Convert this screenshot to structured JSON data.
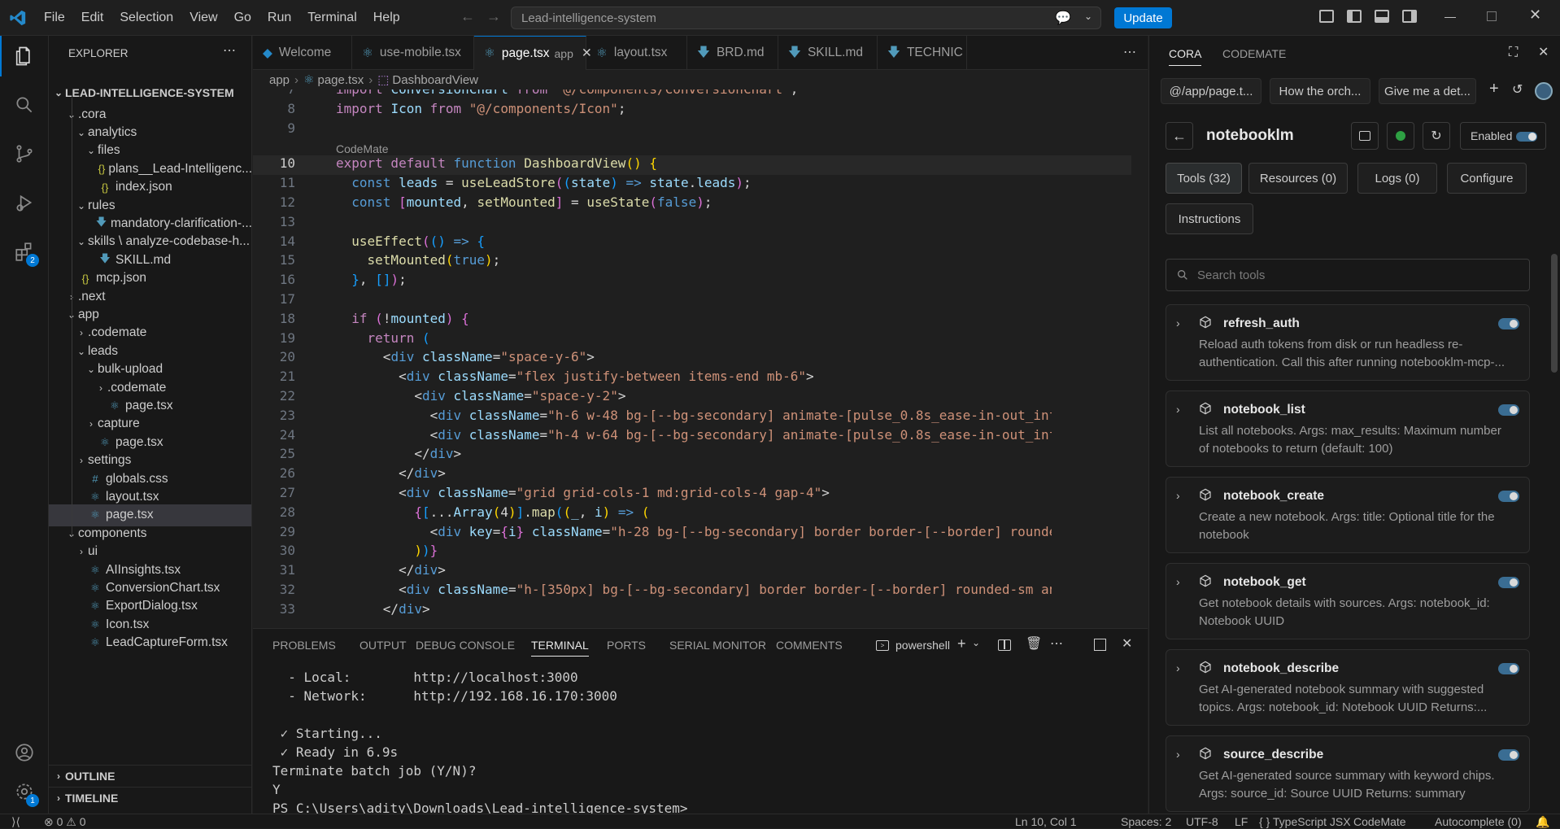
{
  "title_bar": {
    "menu": [
      "File",
      "Edit",
      "Selection",
      "View",
      "Go",
      "Run",
      "Terminal",
      "Help"
    ],
    "search_text": "Lead-intelligence-system",
    "update_label": "Update"
  },
  "activity_bar": {
    "extensions_badge": "2",
    "settings_badge": "1"
  },
  "explorer": {
    "header": "EXPLORER",
    "root": "LEAD-INTELLIGENCE-SYSTEM",
    "items": [
      {
        "label": ".cora",
        "indent": 1,
        "twisty": "open",
        "icon": "none"
      },
      {
        "label": "analytics",
        "indent": 2,
        "twisty": "open",
        "icon": "none"
      },
      {
        "label": "files",
        "indent": 3,
        "twisty": "open",
        "icon": "none"
      },
      {
        "label": "plans__Lead-Intelligenc...",
        "indent": 4,
        "twisty": "none",
        "icon": "json"
      },
      {
        "label": "index.json",
        "indent": 3,
        "twisty": "none",
        "icon": "json"
      },
      {
        "label": "rules",
        "indent": 2,
        "twisty": "open",
        "icon": "none"
      },
      {
        "label": "mandatory-clarification-...",
        "indent": 3,
        "twisty": "none",
        "icon": "md"
      },
      {
        "label": "skills \\ analyze-codebase-h...",
        "indent": 2,
        "twisty": "open",
        "icon": "none"
      },
      {
        "label": "SKILL.md",
        "indent": 3,
        "twisty": "none",
        "icon": "md"
      },
      {
        "label": "mcp.json",
        "indent": 1,
        "twisty": "none",
        "icon": "json"
      },
      {
        "label": ".next",
        "indent": 1,
        "twisty": "closed",
        "icon": "none"
      },
      {
        "label": "app",
        "indent": 1,
        "twisty": "open",
        "icon": "none"
      },
      {
        "label": ".codemate",
        "indent": 2,
        "twisty": "closed",
        "icon": "none"
      },
      {
        "label": "leads",
        "indent": 2,
        "twisty": "open",
        "icon": "none"
      },
      {
        "label": "bulk-upload",
        "indent": 3,
        "twisty": "open",
        "icon": "none"
      },
      {
        "label": ".codemate",
        "indent": 4,
        "twisty": "closed",
        "icon": "none"
      },
      {
        "label": "page.tsx",
        "indent": 4,
        "twisty": "none",
        "icon": "react"
      },
      {
        "label": "capture",
        "indent": 3,
        "twisty": "closed",
        "icon": "none"
      },
      {
        "label": "page.tsx",
        "indent": 3,
        "twisty": "none",
        "icon": "react"
      },
      {
        "label": "settings",
        "indent": 2,
        "twisty": "closed",
        "icon": "none"
      },
      {
        "label": "globals.css",
        "indent": 2,
        "twisty": "none",
        "icon": "css"
      },
      {
        "label": "layout.tsx",
        "indent": 2,
        "twisty": "none",
        "icon": "react"
      },
      {
        "label": "page.tsx",
        "indent": 2,
        "twisty": "none",
        "icon": "react",
        "selected": true
      },
      {
        "label": "components",
        "indent": 1,
        "twisty": "open",
        "icon": "none"
      },
      {
        "label": "ui",
        "indent": 2,
        "twisty": "closed",
        "icon": "none"
      },
      {
        "label": "AIInsights.tsx",
        "indent": 2,
        "twisty": "none",
        "icon": "react"
      },
      {
        "label": "ConversionChart.tsx",
        "indent": 2,
        "twisty": "none",
        "icon": "react"
      },
      {
        "label": "ExportDialog.tsx",
        "indent": 2,
        "twisty": "none",
        "icon": "react"
      },
      {
        "label": "Icon.tsx",
        "indent": 2,
        "twisty": "none",
        "icon": "react"
      },
      {
        "label": "LeadCaptureForm.tsx",
        "indent": 2,
        "twisty": "none",
        "icon": "react"
      }
    ],
    "outline": "OUTLINE",
    "timeline": "TIMELINE"
  },
  "editor": {
    "tabs": [
      {
        "label": "Welcome",
        "icon": "vscode"
      },
      {
        "label": "use-mobile.tsx",
        "icon": "react"
      },
      {
        "label": "page.tsx",
        "suffix": "app",
        "icon": "react",
        "active": true
      },
      {
        "label": "layout.tsx",
        "icon": "react"
      },
      {
        "label": "BRD.md",
        "icon": "md"
      },
      {
        "label": "SKILL.md",
        "icon": "md"
      },
      {
        "label": "TECHNIC",
        "icon": "md"
      }
    ],
    "breadcrumb": [
      "app",
      "page.tsx",
      "DashboardView"
    ],
    "codelens": "CodeMate",
    "current_line": 10
  },
  "panel": {
    "tabs": [
      "PROBLEMS",
      "OUTPUT",
      "DEBUG CONSOLE",
      "TERMINAL",
      "PORTS",
      "SERIAL MONITOR",
      "COMMENTS"
    ],
    "active_tab": "TERMINAL",
    "shell": "powershell",
    "terminal_lines": [
      "  - Local:        http://localhost:3000",
      "  - Network:      http://192.168.16.170:3000",
      "",
      " ✓ Starting...",
      " ✓ Ready in 6.9s",
      "Terminate batch job (Y/N)?",
      "Y",
      "PS C:\\Users\\adity\\Downloads\\Lead-intelligence-system>"
    ]
  },
  "cora": {
    "tabs": [
      "CORA",
      "CODEMATE"
    ],
    "chips": [
      "@/app/page.t...",
      "How the orch...",
      "Give me a det..."
    ],
    "server_name": "notebooklm",
    "enabled_label": "Enabled",
    "filters": [
      "Tools (32)",
      "Resources (0)",
      "Logs (0)",
      "Configure",
      "Instructions"
    ],
    "search_placeholder": "Search tools",
    "tools": [
      {
        "name": "refresh_auth",
        "desc": "Reload auth tokens from disk or run headless re-authentication. Call this after running notebooklm-mcp-..."
      },
      {
        "name": "notebook_list",
        "desc": "List all notebooks. Args: max_results: Maximum number of notebooks to return (default: 100)"
      },
      {
        "name": "notebook_create",
        "desc": "Create a new notebook. Args: title: Optional title for the notebook"
      },
      {
        "name": "notebook_get",
        "desc": "Get notebook details with sources. Args: notebook_id: Notebook UUID"
      },
      {
        "name": "notebook_describe",
        "desc": "Get AI-generated notebook summary with suggested topics. Args: notebook_id: Notebook UUID Returns:..."
      },
      {
        "name": "source_describe",
        "desc": "Get AI-generated source summary with keyword chips. Args: source_id: Source UUID Returns: summary (markdow..."
      }
    ]
  },
  "status_bar": {
    "errors": "0",
    "warnings": "0",
    "position": "Ln 10, Col 1",
    "spaces": "Spaces: 2",
    "encoding": "UTF-8",
    "eol": "LF",
    "language": "TypeScript JSX",
    "codemate": "CodeMate",
    "autocomplete": "Autocomplete (0)"
  },
  "colors": {
    "accent": "#0078d4",
    "background": "#1f1f1f",
    "sidebar": "#181818",
    "selection": "#37373d"
  }
}
